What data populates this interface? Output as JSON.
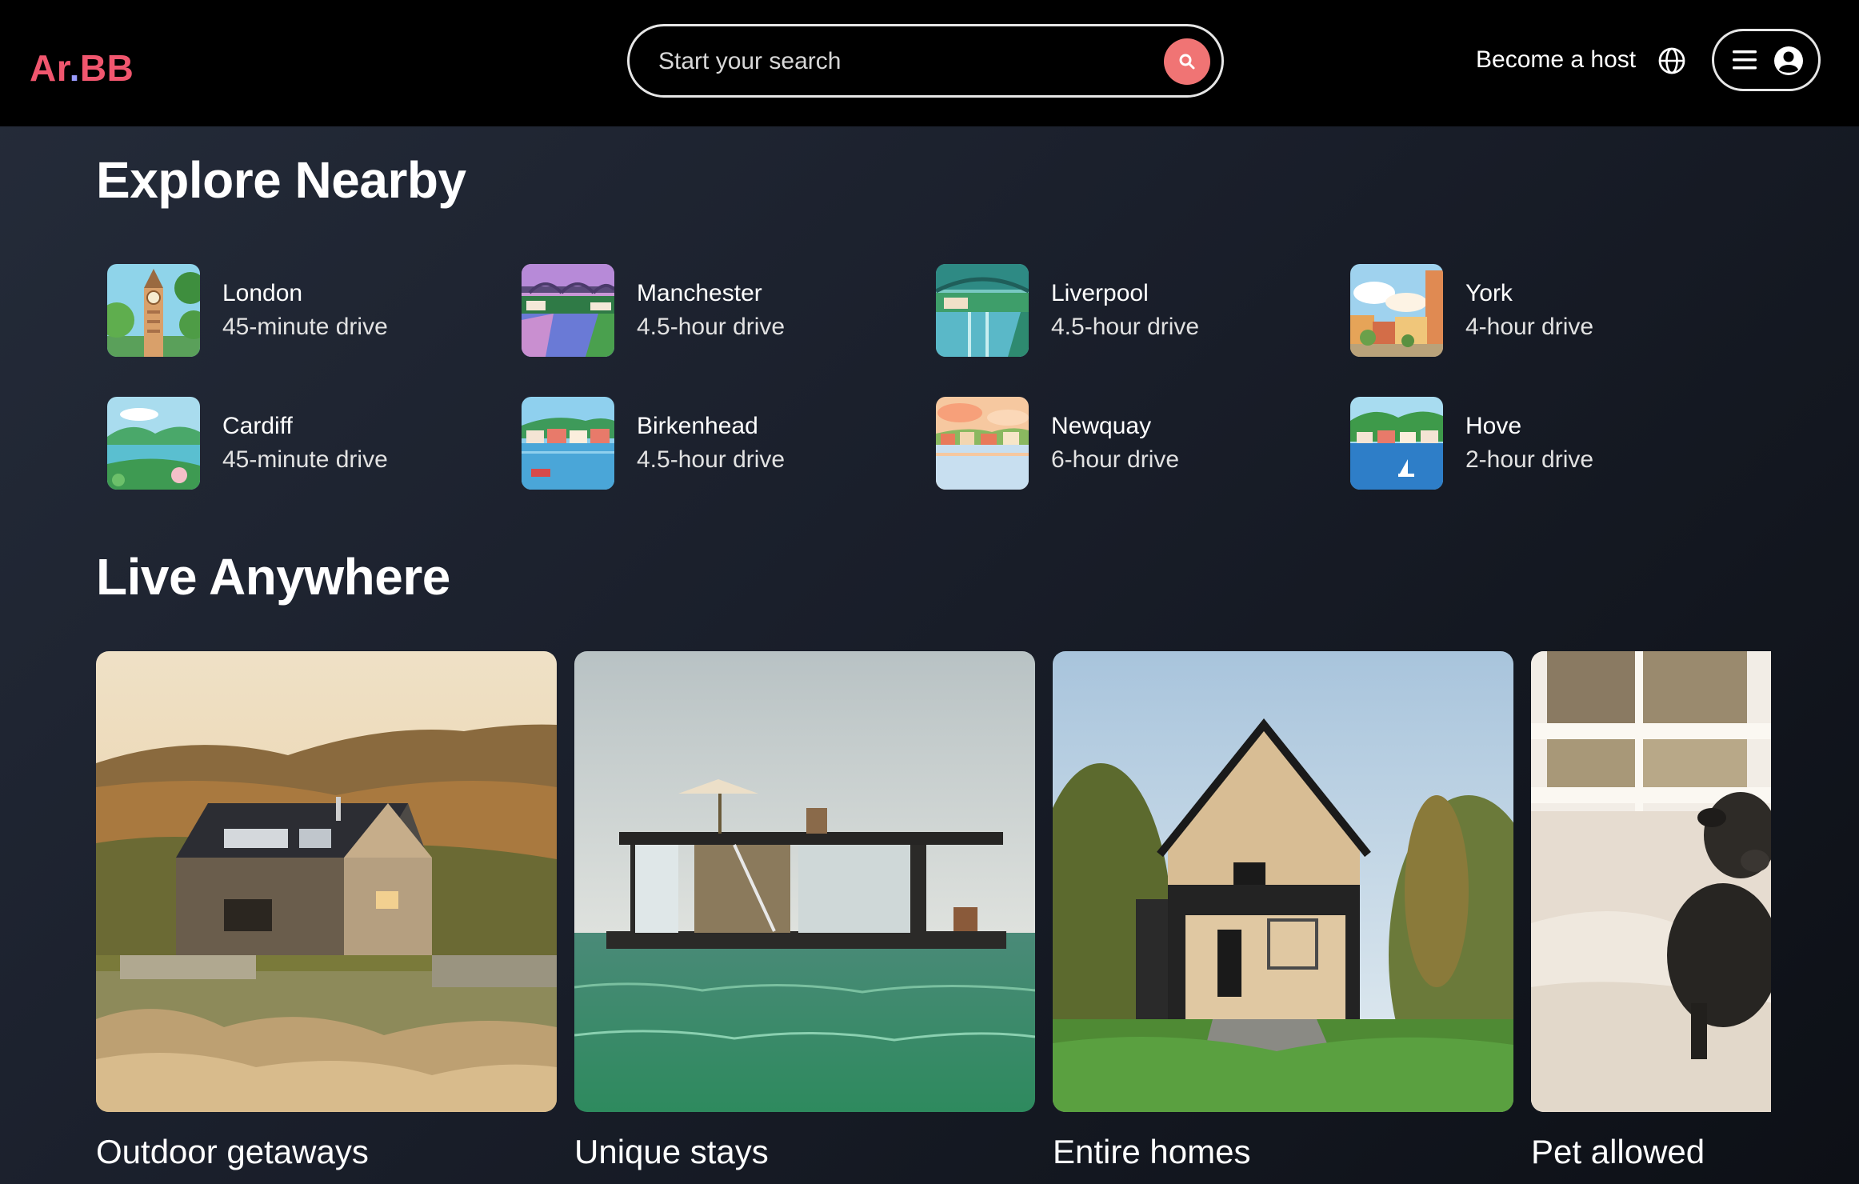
{
  "header": {
    "logo_main": "Ar",
    "logo_dot": ".",
    "logo_end": "BB",
    "search_placeholder": "Start your search",
    "host_label": "Become a host"
  },
  "icons": {
    "search": "search-icon",
    "globe": "globe-icon",
    "menu": "menu-icon",
    "user": "user-avatar-icon"
  },
  "explore": {
    "title": "Explore Nearby",
    "places": [
      {
        "name": "London",
        "distance": "45-minute drive"
      },
      {
        "name": "Manchester",
        "distance": "4.5-hour drive"
      },
      {
        "name": "Liverpool",
        "distance": "4.5-hour drive"
      },
      {
        "name": "York",
        "distance": "4-hour drive"
      },
      {
        "name": "Cardiff",
        "distance": "45-minute drive"
      },
      {
        "name": "Birkenhead",
        "distance": "4.5-hour drive"
      },
      {
        "name": "Newquay",
        "distance": "6-hour drive"
      },
      {
        "name": "Hove",
        "distance": "2-hour drive"
      }
    ]
  },
  "live": {
    "title": "Live Anywhere",
    "cards": [
      {
        "title": "Outdoor getaways"
      },
      {
        "title": "Unique stays"
      },
      {
        "title": "Entire homes"
      },
      {
        "title": "Pet allowed"
      }
    ]
  },
  "colors": {
    "brand": "#f0566e",
    "logo_dot": "#9a9cff",
    "search_button": "#f07474",
    "header_bg": "#000000"
  }
}
